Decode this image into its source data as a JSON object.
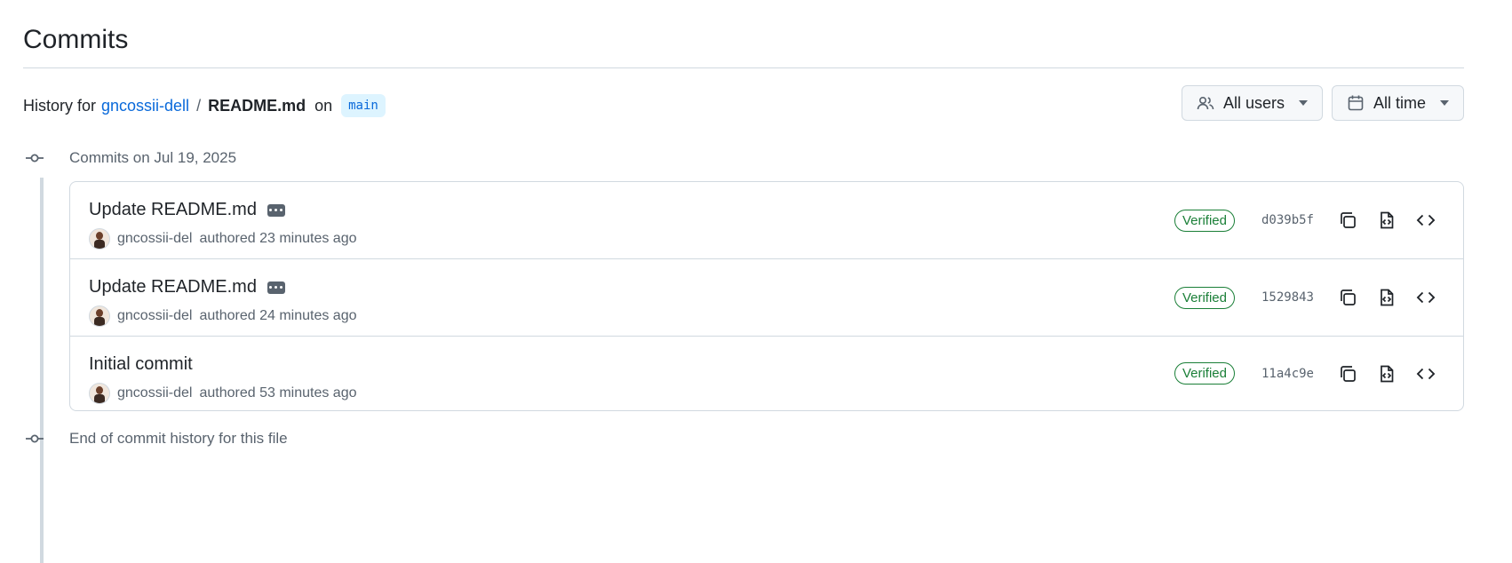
{
  "page": {
    "title": "Commits"
  },
  "history": {
    "prefix": "History for",
    "repo_owner": "gncossii-dell",
    "separator": "/",
    "file": "README.md",
    "on_label": "on",
    "branch": "main"
  },
  "filters": {
    "users_label": "All users",
    "time_label": "All time"
  },
  "timeline": {
    "group_label": "Commits on Jul 19, 2025",
    "end_label": "End of commit history for this file"
  },
  "commits": [
    {
      "title": "Update README.md",
      "has_ellipsis": true,
      "author": "gncossii-del",
      "authored": "authored 23 minutes ago",
      "status": "Verified",
      "sha": "d039b5f"
    },
    {
      "title": "Update README.md",
      "has_ellipsis": true,
      "author": "gncossii-del",
      "authored": "authored 24 minutes ago",
      "status": "Verified",
      "sha": "1529843"
    },
    {
      "title": "Initial commit",
      "has_ellipsis": false,
      "author": "gncossii-del",
      "authored": "authored 53 minutes ago",
      "status": "Verified",
      "sha": "11a4c9e"
    }
  ],
  "colors": {
    "link": "#0969da",
    "verified": "#1a7f37",
    "border": "#d1d9e0",
    "muted": "#59636e"
  }
}
